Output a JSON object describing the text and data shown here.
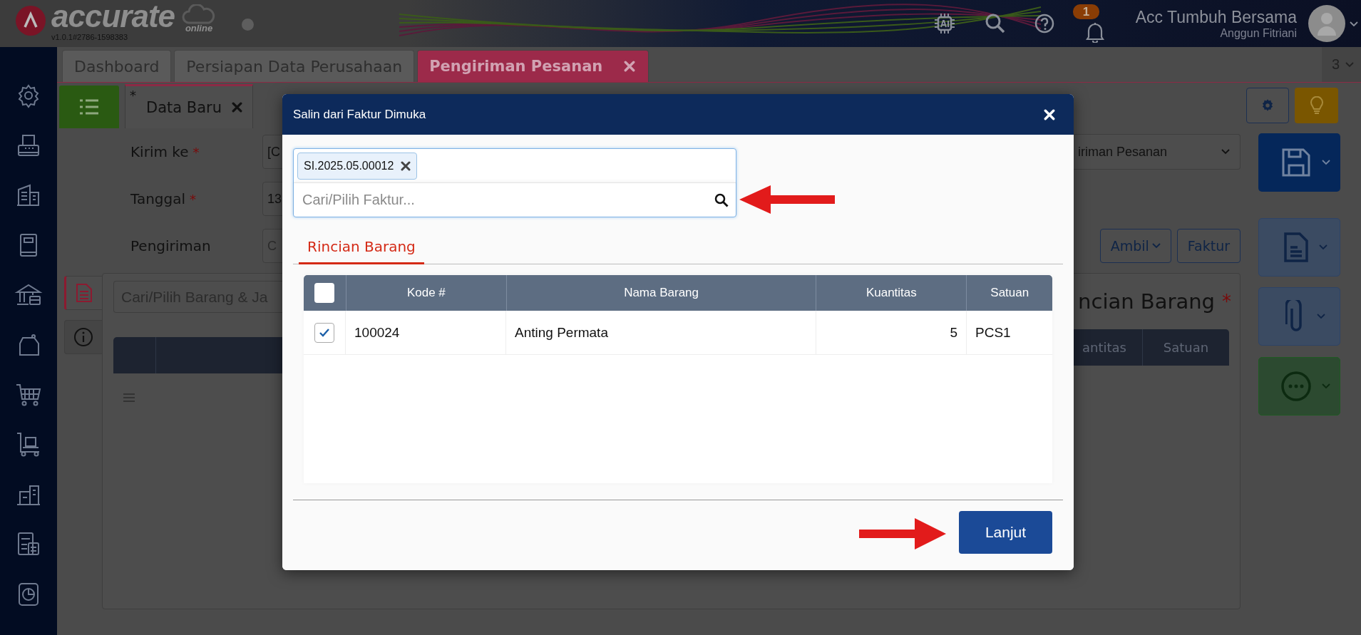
{
  "app": {
    "logo_text": "accurate",
    "logo_sub": "online",
    "version": "v1.0.1#2786-1598383"
  },
  "header": {
    "notification_count": "1",
    "company": "Acc Tumbuh Bersama",
    "user": "Anggun Fitriani"
  },
  "tabs": [
    {
      "label": "Dashboard",
      "selected": false,
      "closable": false
    },
    {
      "label": "Persiapan Data Perusahaan",
      "selected": false,
      "closable": false
    },
    {
      "label": "Pengiriman Pesanan",
      "selected": true,
      "closable": true
    }
  ],
  "tab_count": "3",
  "doc_tab": {
    "modified_mark": "*",
    "label": "Data Baru",
    "closable": true
  },
  "form": {
    "fields": [
      {
        "label": "Kirim ke",
        "required_mark": "*",
        "value": "[C"
      },
      {
        "label": "Tanggal",
        "required_mark": "*",
        "value": "13"
      },
      {
        "label": "Pengiriman",
        "placeholder": "C"
      }
    ],
    "type_select": "iriman Pesanan",
    "buttons": [
      {
        "label": "Ambil",
        "dropdown": true
      },
      {
        "label": "Faktur",
        "dropdown": false
      }
    ]
  },
  "detail": {
    "side_tabs": [
      {
        "kind": "document",
        "selected": true
      },
      {
        "kind": "info",
        "selected": false
      }
    ],
    "search_placeholder": "Cari/Pilih Barang & Ja",
    "title": "ncian Barang",
    "title_mark": "*",
    "columns": [
      "antitas",
      "Satuan"
    ]
  },
  "modal": {
    "title": "Salin dari Faktur Dimuka",
    "selected_invoices": [
      "SI.2025.05.00012"
    ],
    "search_placeholder": "Cari/Pilih Faktur...",
    "tabs": [
      {
        "label": "Rincian Barang",
        "selected": true
      }
    ],
    "table": {
      "all_checked": false,
      "columns": [
        "Kode #",
        "Nama Barang",
        "Kuantitas",
        "Satuan"
      ],
      "rows": [
        {
          "checked": true,
          "cells": [
            "100024",
            "Anting Permata",
            "5",
            "PCS1"
          ]
        }
      ]
    },
    "submit": "Lanjut"
  }
}
